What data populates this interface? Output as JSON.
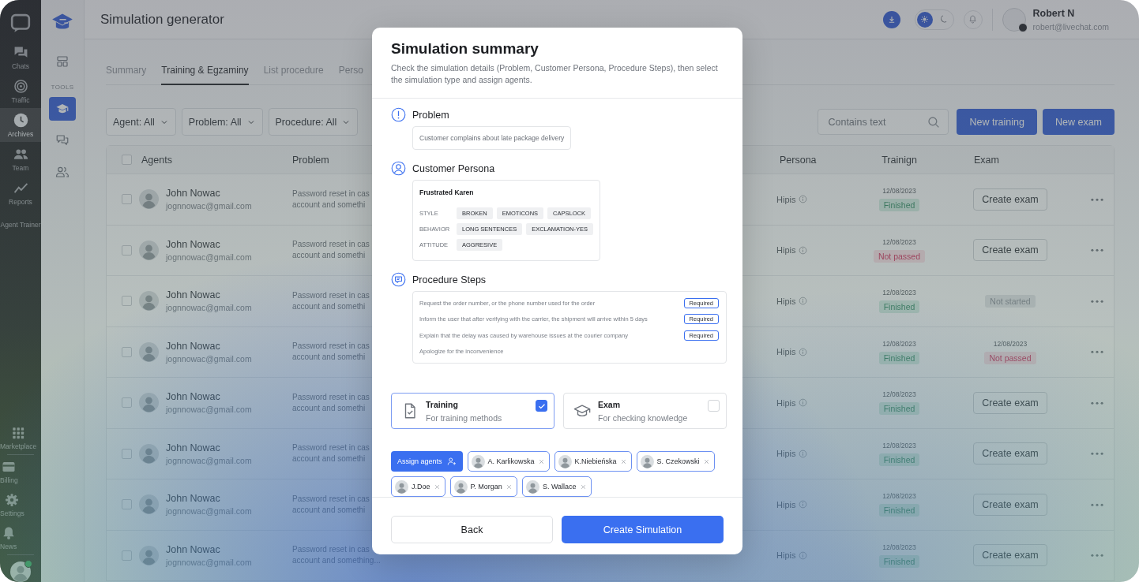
{
  "sidebar": {
    "items": [
      {
        "label": "Chats",
        "kind": "icon",
        "selected": false
      },
      {
        "label": "Traffic",
        "kind": "icon",
        "selected": false
      },
      {
        "label": "Archives",
        "kind": "icon",
        "selected": true
      },
      {
        "label": "Team",
        "kind": "icon",
        "selected": false
      },
      {
        "label": "Reports",
        "kind": "icon",
        "selected": false
      },
      {
        "label": "Agent Trainer",
        "kind": "text",
        "selected": false
      }
    ],
    "bottom_items": [
      {
        "label": "Marketplace",
        "selected": false
      },
      {
        "label": "Billing",
        "selected": false
      },
      {
        "label": "Settings",
        "selected": false
      },
      {
        "label": "News",
        "selected": false
      }
    ]
  },
  "subnav": {
    "section_label": "TOOLS",
    "top_items": [
      {
        "selected": false
      }
    ],
    "tool_items": [
      {
        "selected": true
      },
      {
        "selected": false
      },
      {
        "selected": false
      }
    ]
  },
  "header": {
    "title": "Simulation generator",
    "theme_options": [
      {
        "selected": true
      },
      {
        "selected": false
      }
    ],
    "user": {
      "name": "Robert N",
      "email": "robert@livechat.com"
    }
  },
  "tabs": [
    {
      "label": "Summary",
      "selected": false
    },
    {
      "label": "Training & Egzaminy",
      "selected": true
    },
    {
      "label": "List procedure",
      "selected": false
    },
    {
      "label": "Perso",
      "selected": false
    }
  ],
  "filters": [
    {
      "label": "Agent: All"
    },
    {
      "label": "Problem: All"
    },
    {
      "label": "Procedure: All"
    }
  ],
  "search": {
    "placeholder": "Contains text"
  },
  "actions": [
    "New training",
    "New exam"
  ],
  "table": {
    "columns": [
      "Agents",
      "Problem",
      "Persona",
      "Trainign",
      "Exam"
    ],
    "select_all_checked": false,
    "rows": [
      {
        "checked": false,
        "name": "John Nowac",
        "email": "jognnowac@gmail.com",
        "problem": "Password reset in cas\naccount and somethi",
        "persona": "Hipis",
        "training": {
          "date": "12/08/2023",
          "status": "Finished",
          "kind": "success"
        },
        "exam": {
          "kind": "button",
          "label": "Create exam"
        }
      },
      {
        "checked": false,
        "name": "John Nowac",
        "email": "jognnowac@gmail.com",
        "problem": "Password reset in cas\naccount and somethi",
        "persona": "Hipis",
        "training": {
          "date": "12/08/2023",
          "status": "Not passed",
          "kind": "danger"
        },
        "exam": {
          "kind": "button",
          "label": "Create exam"
        }
      },
      {
        "checked": false,
        "name": "John Nowac",
        "email": "jognnowac@gmail.com",
        "problem": "Password reset in cas\naccount and somethi",
        "persona": "Hipis",
        "training": {
          "date": "12/08/2023",
          "status": "Finished",
          "kind": "success"
        },
        "exam": {
          "kind": "status",
          "badge": {
            "text": "Not started",
            "kind": "neutral"
          }
        }
      },
      {
        "checked": false,
        "name": "John Nowac",
        "email": "jognnowac@gmail.com",
        "problem": "Password reset in cas\naccount and somethi",
        "persona": "Hipis",
        "training": {
          "date": "12/08/2023",
          "status": "Finished",
          "kind": "success"
        },
        "exam": {
          "kind": "result",
          "date": "12/08/2023",
          "badge": {
            "text": "Not passed",
            "kind": "danger"
          }
        }
      },
      {
        "checked": false,
        "name": "John Nowac",
        "email": "jognnowac@gmail.com",
        "problem": "Password reset in cas\naccount and somethi",
        "persona": "Hipis",
        "training": {
          "date": "12/08/2023",
          "status": "Finished",
          "kind": "success"
        },
        "exam": {
          "kind": "button",
          "label": "Create exam"
        }
      },
      {
        "checked": false,
        "name": "John Nowac",
        "email": "jognnowac@gmail.com",
        "problem": "Password reset in cas\naccount and somethi",
        "persona": "Hipis",
        "training": {
          "date": "12/08/2023",
          "status": "Finished",
          "kind": "success"
        },
        "exam": {
          "kind": "button",
          "label": "Create exam"
        }
      },
      {
        "checked": false,
        "name": "John Nowac",
        "email": "jognnowac@gmail.com",
        "problem": "Password reset in cas\naccount and somethi",
        "persona": "Hipis",
        "training": {
          "date": "12/08/2023",
          "status": "Finished",
          "kind": "success"
        },
        "exam": {
          "kind": "button",
          "label": "Create exam"
        }
      },
      {
        "checked": false,
        "name": "John Nowac",
        "email": "jognnowac@gmail.com",
        "problem": "Password reset in cas\naccount and something...",
        "persona": "Hipis",
        "training": {
          "date": "12/08/2023",
          "status": "Finished",
          "kind": "success"
        },
        "exam": {
          "kind": "button",
          "label": "Create exam"
        }
      }
    ]
  },
  "modal": {
    "title": "Simulation summary",
    "description": "Check the simulation details (Problem, Customer Persona, Procedure Steps), then select the simulation type and assign agents.",
    "problem": {
      "title": "Problem",
      "text": "Customer complains about late package delivery"
    },
    "persona": {
      "title": "Customer Persona",
      "name": "Frustrated Karen",
      "traits": [
        {
          "label": "STYLE",
          "tags": [
            "BROKEN",
            "EMOTICONS",
            "CAPSLOCK"
          ]
        },
        {
          "label": "BEHAVIOR",
          "tags": [
            "LONG SENTENCES",
            "EXCLAMATION-YES"
          ]
        },
        {
          "label": "ATTITUDE",
          "tags": [
            "AGGRESIVE"
          ]
        }
      ]
    },
    "procedure": {
      "title": "Procedure Steps",
      "steps": [
        {
          "text": "Request the order number, or the phone number used for the order",
          "badge": "Required"
        },
        {
          "text": "Inform the user that after verifying with the carrier, the shipment will arrive within 5 days",
          "badge": "Required"
        },
        {
          "text": "Explain that the delay was caused by warehouse issues at the courier company",
          "badge": "Required"
        },
        {
          "text": "Apologize for the inconvenience"
        }
      ]
    },
    "types": [
      {
        "title": "Training",
        "subtitle": "For training methods",
        "checked": true
      },
      {
        "title": "Exam",
        "subtitle": "For checking knowledge",
        "checked": false
      }
    ],
    "assign": {
      "button": "Assign agents",
      "agents": [
        {
          "name": "A. Karlikowska"
        },
        {
          "name": "K.Niebieńska"
        },
        {
          "name": "S. Czekowski"
        },
        {
          "name": "J.Doe"
        },
        {
          "name": "P. Morgan"
        },
        {
          "name": "S. Wallace"
        }
      ]
    },
    "buttons": [
      {
        "label": "Back",
        "kind": "secondary"
      },
      {
        "label": "Create Simulation",
        "kind": "primary"
      }
    ]
  }
}
